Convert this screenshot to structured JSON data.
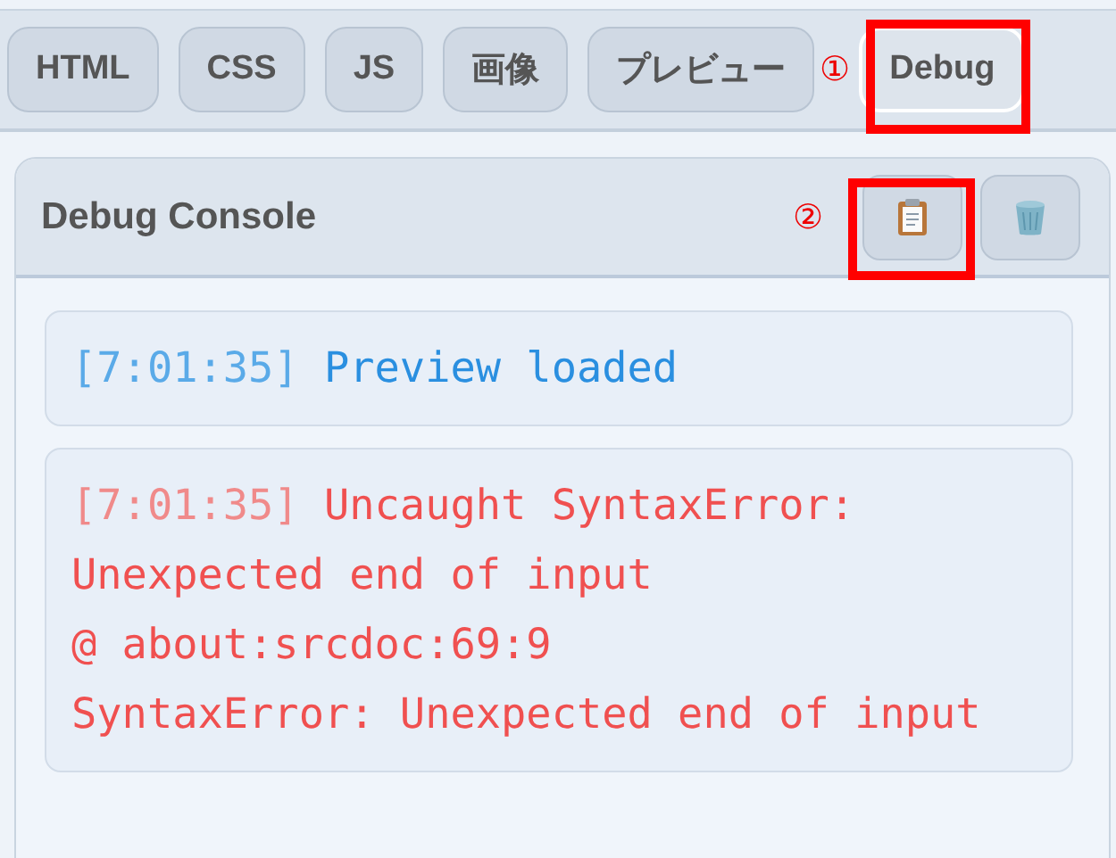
{
  "tabs": [
    {
      "label": "HTML",
      "selected": false
    },
    {
      "label": "CSS",
      "selected": false
    },
    {
      "label": "JS",
      "selected": false
    },
    {
      "label": "画像",
      "selected": false
    },
    {
      "label": "プレビュー",
      "selected": false
    },
    {
      "label": "Debug",
      "selected": true,
      "callout": "①",
      "highlighted": true
    }
  ],
  "console": {
    "title": "Debug Console",
    "buttons": [
      {
        "kind": "copy",
        "callout": "②",
        "highlighted": true
      },
      {
        "kind": "clear",
        "highlighted": false
      }
    ],
    "entries": [
      {
        "kind": "info",
        "time": "[7:01:35]",
        "message": "Preview loaded"
      },
      {
        "kind": "error",
        "time": "[7:01:35]",
        "message": "Uncaught SyntaxError: Unexpected end of input\n@ about:srcdoc:69:9\nSyntaxError: Unexpected end of input"
      }
    ]
  }
}
